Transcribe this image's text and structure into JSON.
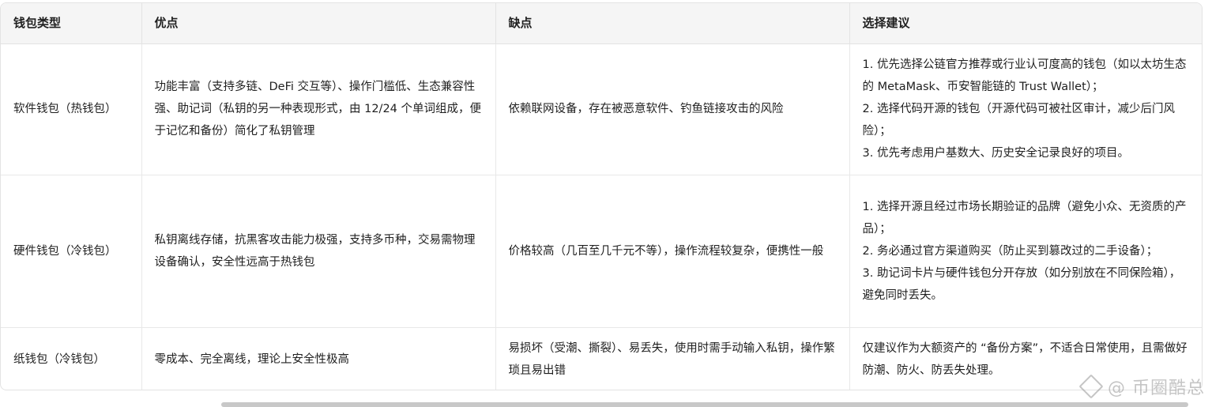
{
  "table": {
    "headers": [
      "钱包类型",
      "优点",
      "缺点",
      "选择建议"
    ],
    "rows": [
      {
        "type": "软件钱包（热钱包）",
        "pros": "功能丰富（支持多链、DeFi 交互等）、操作门槛低、生态兼容性强、助记词（私钥的另一种表现形式，由 12/24 个单词组成，便于记忆和备份）简化了私钥管理",
        "cons": "依赖联网设备，存在被恶意软件、钓鱼链接攻击的风险",
        "advice": [
          "1. 优先选择公链官方推荐或行业认可度高的钱包（如以太坊生态的 MetaMask、币安智能链的 Trust Wallet）；",
          "2. 选择代码开源的钱包（开源代码可被社区审计，减少后门风险）；",
          "3. 优先考虑用户基数大、历史安全记录良好的项目。"
        ]
      },
      {
        "type": "硬件钱包（冷钱包）",
        "pros": "私钥离线存储，抗黑客攻击能力极强，支持多币种，交易需物理设备确认，安全性远高于热钱包",
        "cons": "价格较高（几百至几千元不等），操作流程较复杂，便携性一般",
        "advice": [
          "1. 选择开源且经过市场长期验证的品牌（避免小众、无资质的产品）；",
          "2. 务必通过官方渠道购买（防止买到篡改过的二手设备）；",
          "3. 助记词卡片与硬件钱包分开存放（如分别放在不同保险箱），避免同时丢失。"
        ]
      },
      {
        "type": "纸钱包（冷钱包）",
        "pros": "零成本、完全离线，理论上安全性极高",
        "cons": "易损坏（受潮、撕裂）、易丢失，使用时需手动输入私钥，操作繁琐且易出错",
        "advice": [
          "仅建议作为大额资产的 “备份方案”，不适合日常使用，且需做好防潮、防火、防丢失处理。"
        ]
      }
    ]
  },
  "watermark": {
    "text": "@ 币圈酷总",
    "icon": "diamond-logo-icon"
  }
}
